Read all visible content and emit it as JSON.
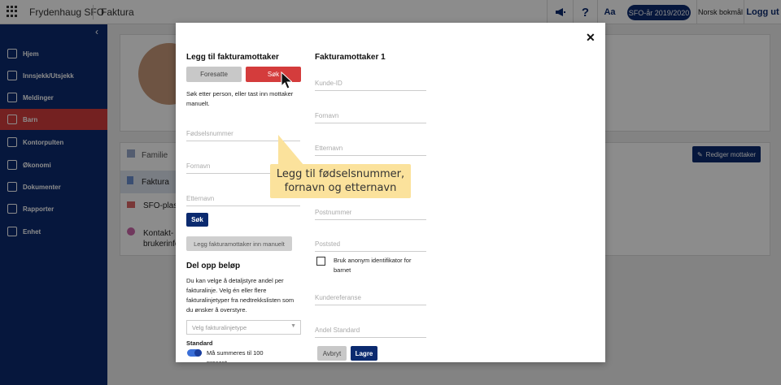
{
  "topbar": {
    "app_name": "Frydenhaug SFO",
    "section": "Faktura",
    "font_label": "Aa",
    "year": "SFO-år 2019/2020",
    "language": "Norsk bokmål",
    "logout": "Logg ut"
  },
  "sidebar": {
    "items": [
      {
        "label": "Hjem"
      },
      {
        "label": "Innsjekk/Utsjekk"
      },
      {
        "label": "Meldinger"
      },
      {
        "label": "Barn"
      },
      {
        "label": "Kontorpulten"
      },
      {
        "label": "Økonomi"
      },
      {
        "label": "Dokumenter"
      },
      {
        "label": "Rapporter"
      },
      {
        "label": "Enhet"
      }
    ]
  },
  "background": {
    "sections": [
      "Familie",
      "Faktura",
      "SFO-plas",
      "Kontakt-",
      "brukerinfo"
    ],
    "edit_button": "Rediger mottaker"
  },
  "modal": {
    "left_title": "Legg til fakturamottaker",
    "tab_guardian": "Foresatte",
    "tab_search": "Søk",
    "help_text": "Søk etter person, eller tast inn mottaker manuelt.",
    "birth_number_placeholder": "Fødselsnummer",
    "first_name_placeholder": "Fornavn",
    "last_name_placeholder": "Etternavn",
    "search_button": "Søk",
    "add_manual_button": "Legg fakturamottaker inn manuelt",
    "split_title": "Del opp beløp",
    "split_text": "Du kan velge å detaljstyre andel per fakturalinje. Velg én eller flere fakturalinjetyper fra nedtrekkslisten som du ønsker å overstyre.",
    "select_placeholder": "Velg fakturalinjetype",
    "standard_label": "Standard",
    "sum_label": "Må summeres til 100",
    "sum_label_cont": "prosent",
    "right_title": "Fakturamottaker 1",
    "customer_id": "Kunde-ID",
    "r_first_name": "Fornavn",
    "r_last_name": "Etternavn",
    "postal_code": "Postnummer",
    "city": "Poststed",
    "anon_label": "Bruk anonym identifikator for barnet",
    "customer_ref": "Kundereferanse",
    "share_standard": "Andel Standard",
    "cancel_button": "Avbryt",
    "save_button": "Lagre"
  },
  "tooltip": {
    "line1": "Legg til fødselsnummer,",
    "line2": "fornavn og etternavn"
  },
  "colors": {
    "navy": "#0b2a6f",
    "red": "#d43c3c",
    "yellow": "#fbe29c"
  }
}
